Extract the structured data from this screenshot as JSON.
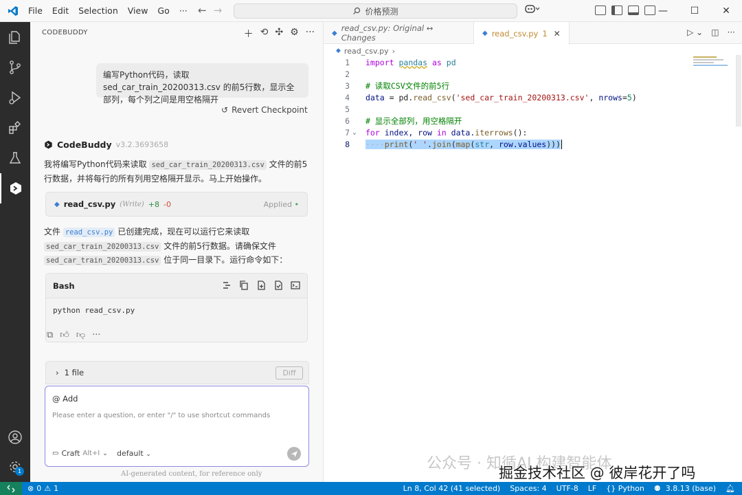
{
  "menu": {
    "items": [
      "File",
      "Edit",
      "Selection",
      "View",
      "Go",
      "···"
    ],
    "search": "价格预测"
  },
  "sidebar": {
    "title": "CODEBUDDY",
    "user_message": "编写Python代码，读取sed_car_train_20200313.csv 的前5行数，显示全部列，每个列之间是用空格隔开",
    "revert_label": "Revert Checkpoint",
    "assistant_name": "CodeBuddy",
    "assistant_version": "v3.2.3693658",
    "para1_a": "我将编写Python代码来读取",
    "para1_code": "sed_car_train_20200313.csv",
    "para1_b": "文件的前5",
    "para1_c": "行数据，并将每行的所有列用空格隔开显示。马上开始操作。",
    "file_card": {
      "name": "read_csv.py",
      "op": "(Write)",
      "added": "+8",
      "removed": "-0",
      "status": "Applied"
    },
    "para2_a": "文件",
    "para2_code1": "read_csv.py",
    "para2_b": "已创建完成，现在可以运行它来读取",
    "para2_code2": "sed_car_train_20200313.csv",
    "para2_c": "文件的前5行数据。请确保文件",
    "para2_code3": "sed_car_train_20200313.csv",
    "para2_d": "位于同一目录下。运行命令如下：",
    "bash": {
      "lang": "Bash",
      "command": "python read_csv.py"
    },
    "files_label": "1 file",
    "diff_label": "Diff",
    "input": {
      "add_label": "@ Add",
      "placeholder": "Please enter a question, or enter \"/\" to use shortcut commands",
      "mode": "Craft",
      "mode_key": "Alt+I",
      "model": "default"
    },
    "disclaimer": "AI-generated content, for reference only",
    "badge_count": "1"
  },
  "editor": {
    "tab_inactive": "read_csv.py: Original ↔ Changes",
    "tab_active": "read_csv.py",
    "tab_active_badge": "1",
    "breadcrumb": "read_csv.py",
    "line_numbers": [
      "1",
      "2",
      "3",
      "4",
      "5",
      "6",
      "7",
      "8"
    ],
    "code": {
      "l1_import": "import",
      "l1_mod": "pandas",
      "l1_as": "as",
      "l1_alias": "pd",
      "l3": "# 读取CSV文件的前5行",
      "l4_var": "data",
      "l4_eq": " = pd.",
      "l4_fn": "read_csv",
      "l4_str": "'sed_car_train_20200313.csv'",
      "l4_prm": "nrows",
      "l4_num": "5",
      "l6": "# 显示全部列，用空格隔开",
      "l7_for": "for",
      "l7_vars": " index, row ",
      "l7_in": "in",
      "l7_rest": " data.",
      "l7_fn": "iterrows",
      "l7_end": "():",
      "l8_ws": "····",
      "l8_fn1": "print",
      "l8_str": "' '",
      "l8_fn2": "join",
      "l8_fn3": "map",
      "l8_type": "str",
      "l8_rest": "row.values"
    }
  },
  "watermark": {
    "line1": "公众号 · 知循AI 构建智能体",
    "line2": "掘金技术社区 @ 彼岸花开了吗"
  },
  "statusbar": {
    "errors": "0",
    "warnings": "1",
    "position": "Ln 8, Col 42 (41 selected)",
    "spaces": "Spaces: 4",
    "encoding": "UTF-8",
    "eol": "LF",
    "language": "Python",
    "interpreter": "3.8.13 (base)"
  },
  "colors": {
    "accent": "#007acc",
    "activity_bar": "#2c2c2c",
    "selection": "#add6ff",
    "keyword": "#0000ff",
    "string": "#a31515",
    "comment": "#008000"
  }
}
